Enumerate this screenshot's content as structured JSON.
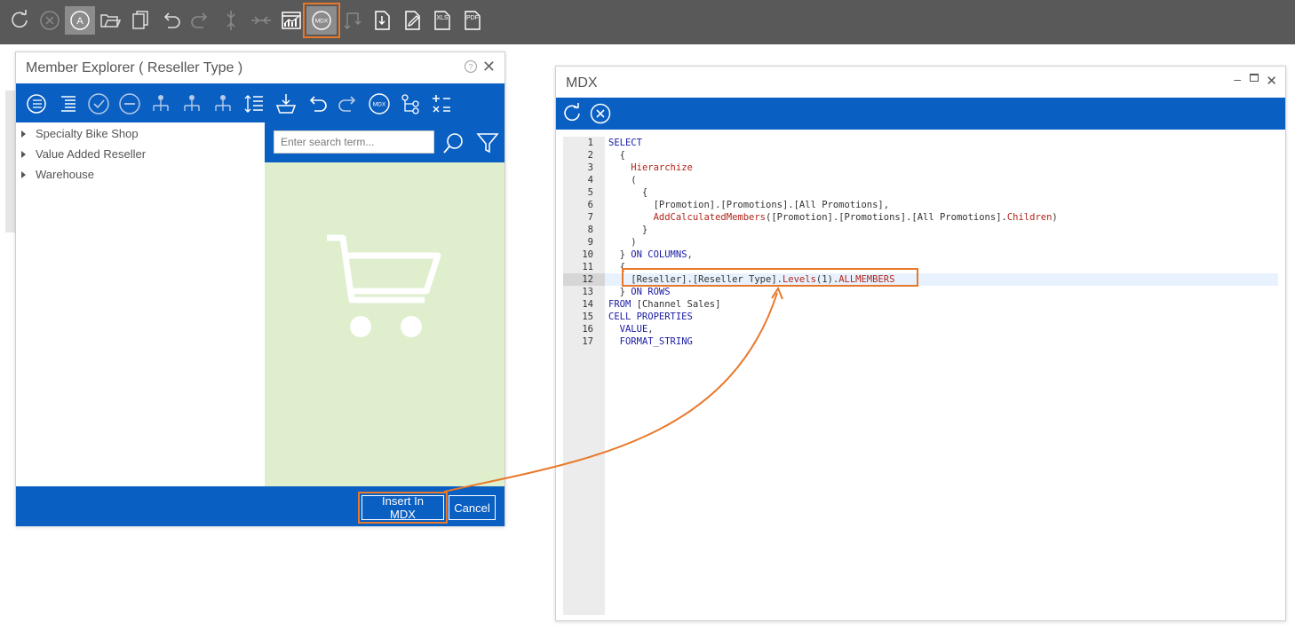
{
  "toolbar": {
    "items": [
      {
        "icon": "refresh-icon"
      },
      {
        "icon": "cancel-icon"
      },
      {
        "icon": "autofit-icon",
        "label": "A"
      },
      {
        "icon": "open-folder-icon"
      },
      {
        "icon": "copy-icon"
      },
      {
        "icon": "undo-icon"
      },
      {
        "icon": "redo-icon"
      },
      {
        "icon": "expand-icon"
      },
      {
        "icon": "collapse-icon"
      },
      {
        "icon": "chart-icon"
      },
      {
        "icon": "mdx-icon",
        "label": "MDX"
      },
      {
        "icon": "swap-icon"
      },
      {
        "icon": "export-icon"
      },
      {
        "icon": "edit-icon"
      },
      {
        "icon": "xls-icon",
        "label": "XLS"
      },
      {
        "icon": "pdf-icon",
        "label": "PDF"
      }
    ]
  },
  "member_explorer": {
    "title": "Member Explorer ( Reseller Type )",
    "tree": [
      "Specialty Bike Shop",
      "Value Added Reseller",
      "Warehouse"
    ],
    "search_placeholder": "Enter search term...",
    "mdx_icon_label": "MDX",
    "insert_label": "Insert In MDX",
    "cancel_label": "Cancel"
  },
  "mdx": {
    "title": "MDX",
    "current_line": 12,
    "lines": [
      [
        {
          "t": "SELECT",
          "c": "k"
        }
      ],
      [
        {
          "t": "  {",
          "c": "p"
        }
      ],
      [
        {
          "t": "    ",
          "c": "p"
        },
        {
          "t": "Hierarchize",
          "c": "f"
        }
      ],
      [
        {
          "t": "    (",
          "c": "p"
        }
      ],
      [
        {
          "t": "      {",
          "c": "p"
        }
      ],
      [
        {
          "t": "        [Promotion].[Promotions].[All Promotions],",
          "c": "p"
        }
      ],
      [
        {
          "t": "        ",
          "c": "p"
        },
        {
          "t": "AddCalculatedMembers",
          "c": "f"
        },
        {
          "t": "([Promotion].[Promotions].[All Promotions].",
          "c": "p"
        },
        {
          "t": "Children",
          "c": "f"
        },
        {
          "t": ")",
          "c": "p"
        }
      ],
      [
        {
          "t": "      }",
          "c": "p"
        }
      ],
      [
        {
          "t": "    )",
          "c": "p"
        }
      ],
      [
        {
          "t": "  } ",
          "c": "p"
        },
        {
          "t": "ON COLUMNS",
          "c": "k"
        },
        {
          "t": ",",
          "c": "p"
        }
      ],
      [
        {
          "t": "  {",
          "c": "p"
        }
      ],
      [
        {
          "t": "    [Reseller].[Reseller Type].",
          "c": "p"
        },
        {
          "t": "Levels",
          "c": "f"
        },
        {
          "t": "(1).",
          "c": "p"
        },
        {
          "t": "ALLMEMBERS",
          "c": "f"
        }
      ],
      [
        {
          "t": "  } ",
          "c": "p"
        },
        {
          "t": "ON ROWS",
          "c": "k"
        }
      ],
      [
        {
          "t": "FROM",
          "c": "k"
        },
        {
          "t": " [Channel Sales]",
          "c": "p"
        }
      ],
      [
        {
          "t": "CELL PROPERTIES",
          "c": "k"
        }
      ],
      [
        {
          "t": "  ",
          "c": "p"
        },
        {
          "t": "VALUE",
          "c": "k"
        },
        {
          "t": ",",
          "c": "p"
        }
      ],
      [
        {
          "t": "  ",
          "c": "p"
        },
        {
          "t": "FORMAT_STRING",
          "c": "k"
        }
      ]
    ]
  },
  "colors": {
    "toolbar_bg": "#595959",
    "accent_blue": "#0a5fc2",
    "highlight_orange": "#e8782a",
    "drop_zone": "#dfeecd"
  }
}
